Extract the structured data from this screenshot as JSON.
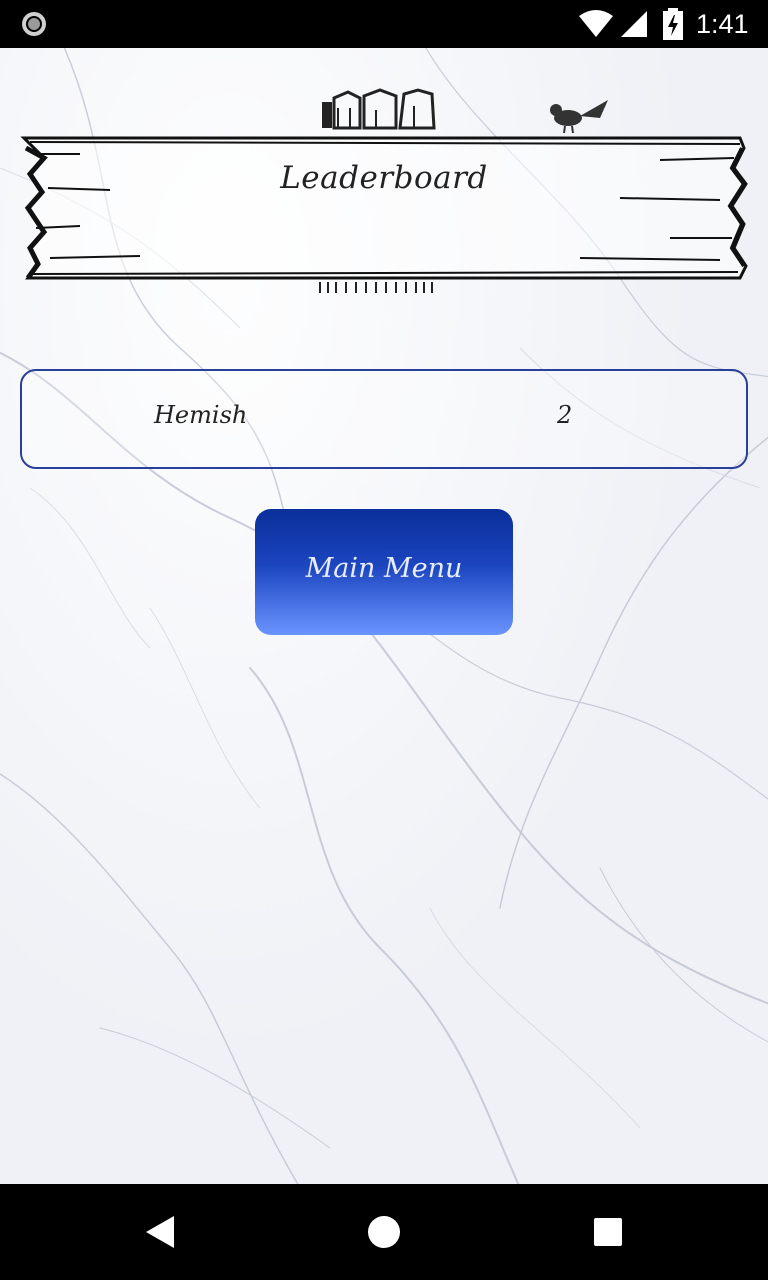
{
  "status_bar": {
    "time": "1:41",
    "icons": [
      "record-icon",
      "wifi-icon",
      "signal-icon",
      "battery-charging-icon"
    ]
  },
  "screen": {
    "title": "Leaderboard"
  },
  "leaderboard": {
    "entries": [
      {
        "name": "Hemish",
        "score": "2"
      }
    ]
  },
  "actions": {
    "main_menu_label": "Main Menu"
  },
  "nav_bar": {
    "icons": [
      "back-icon",
      "home-icon",
      "recents-icon"
    ]
  },
  "colors": {
    "accent": "#1c45c0",
    "border": "#2a3f9a",
    "background": "#eef0f5"
  }
}
